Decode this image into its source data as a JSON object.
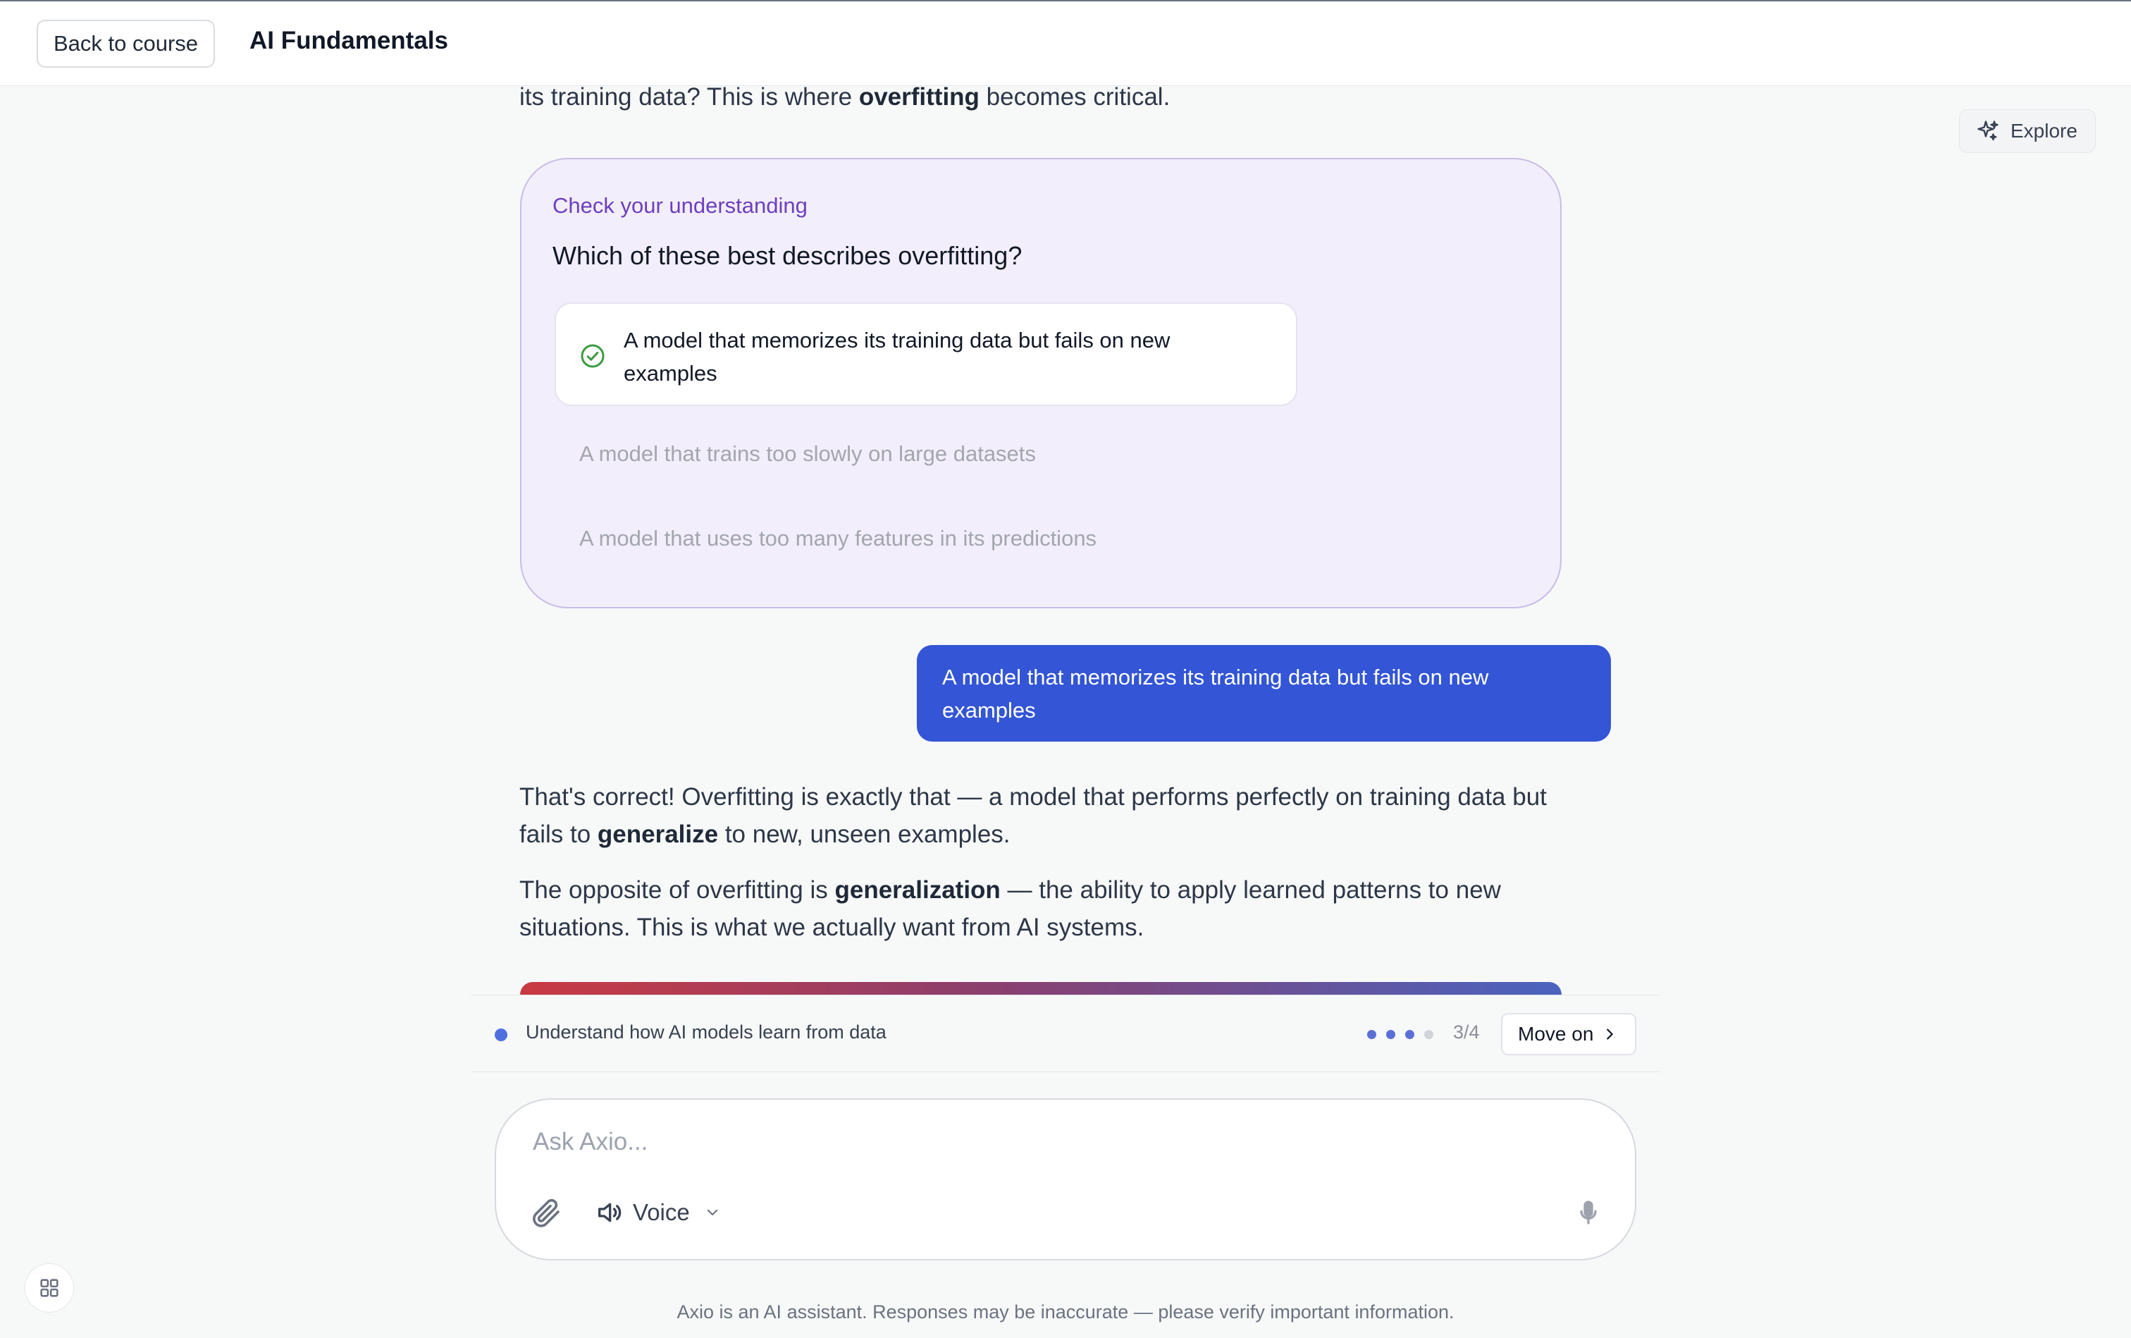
{
  "header": {
    "back_label": "Back to course",
    "title": "AI Fundamentals"
  },
  "explore": {
    "label": "Explore",
    "icon": "sparkles-icon"
  },
  "intro": {
    "pre": "its training data? This is where ",
    "bold": "overfitting",
    "post": " becomes critical."
  },
  "quiz": {
    "kicker": "Check your understanding",
    "question": "Which of these best describes overfitting?",
    "options": [
      {
        "label": "A model that memorizes its training data but fails on new examples",
        "selected": true
      },
      {
        "label": "A model that trains too slowly on large datasets",
        "selected": false
      },
      {
        "label": "A model that uses too many features in its predictions",
        "selected": false
      }
    ]
  },
  "user_message": "A model that memorizes its training data but fails on new examples",
  "reply": {
    "p1_pre": "That's correct! Overfitting is exactly that — a model that performs perfectly on training data but fails to ",
    "p1_bold": "generalize",
    "p1_post": " to new, unseen examples.",
    "p2_pre": "The opposite of overfitting is ",
    "p2_bold": "generalization",
    "p2_post": " — the ability to apply learned patterns to new situations. This is what we actually want from AI systems."
  },
  "progress": {
    "objective": "Understand how AI models learn from data",
    "step_count": "3/4",
    "steps_completed": 3,
    "steps_total": 4,
    "move_on_label": "Move on"
  },
  "composer": {
    "placeholder": "Ask Axio...",
    "value": "",
    "voice_label": "Voice"
  },
  "disclaimer": "Axio is an AI assistant. Responses may be inaccurate — please verify important information.",
  "colors": {
    "accent": "#3355d6",
    "quiz_bg": "#f2eefb",
    "quiz_kicker": "#6d3fbf",
    "correct": "#3a9b3f"
  }
}
